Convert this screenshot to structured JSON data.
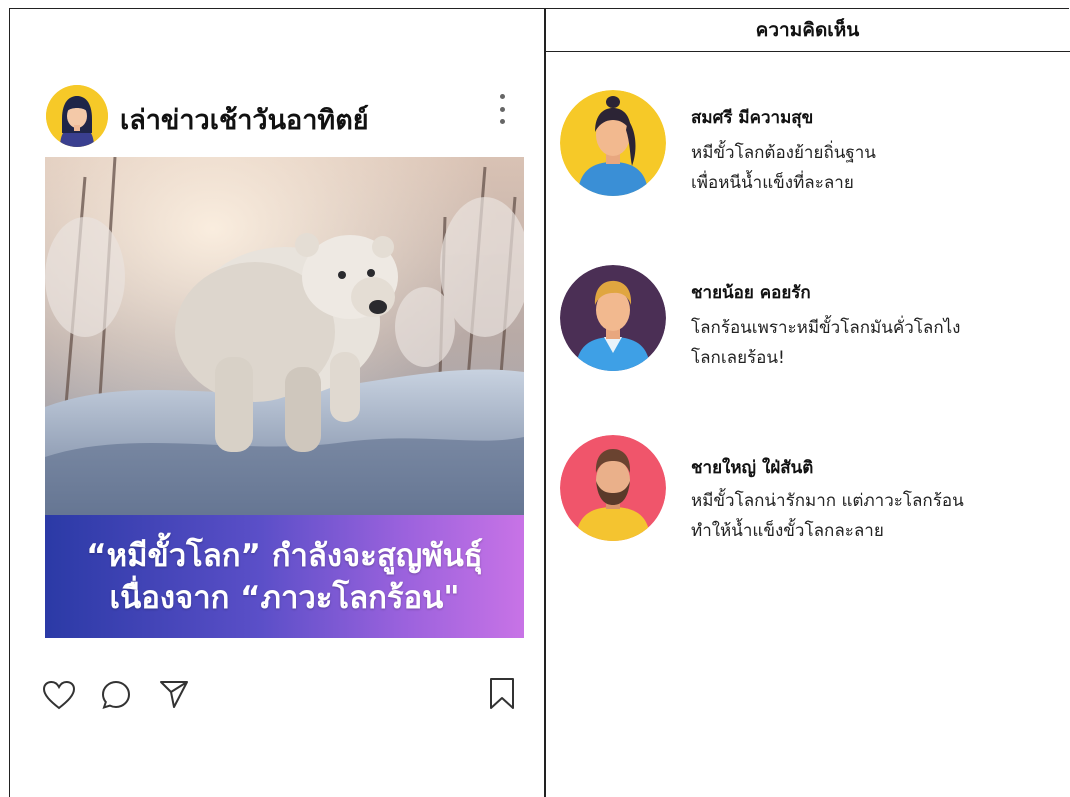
{
  "comments_panel": {
    "title": "ความคิดเห็น",
    "items": [
      {
        "name": "สมศรี มีความสุข",
        "lines": [
          "หมีขั้วโลกต้องย้ายถิ่นฐาน",
          "เพื่อหนีน้ำแข็งที่ละลาย"
        ],
        "avatar": "woman-ponytail-avatar",
        "avatar_bg": "#f6c928"
      },
      {
        "name": "ชายน้อย คอยรัก",
        "lines": [
          "โลกร้อนเพราะหมีขั้วโลกมันคั่วโลกไง",
          "โลกเลยร้อน!"
        ],
        "avatar": "young-man-avatar",
        "avatar_bg": "#4b2f55"
      },
      {
        "name": "ชายใหญ่ ใฝ่สันติ",
        "lines": [
          "หมีขั้วโลกน่ารักมาก แต่ภาวะโลกร้อน",
          "ทำให้น้ำแข็งขั้วโลกละลาย"
        ],
        "avatar": "bearded-man-avatar",
        "avatar_bg": "#f0556b"
      }
    ]
  },
  "post": {
    "username": "เล่าข่าวเช้าวันอาทิตย์",
    "avatar": "woman-avatar",
    "image": "polar-bear-in-snow-image",
    "caption_line1": "“หมีขั้วโลก” กำลังจะสูญพันธุ์",
    "caption_line2": "เนื่องจาก “ภาวะโลกร้อน\"",
    "actions": [
      "heart-icon",
      "comment-icon",
      "share-icon",
      "bookmark-icon"
    ]
  },
  "colors": {
    "banner_start": "#2b3aa6",
    "banner_end": "#c873e6",
    "post_avatar_bg": "#f6c928"
  }
}
